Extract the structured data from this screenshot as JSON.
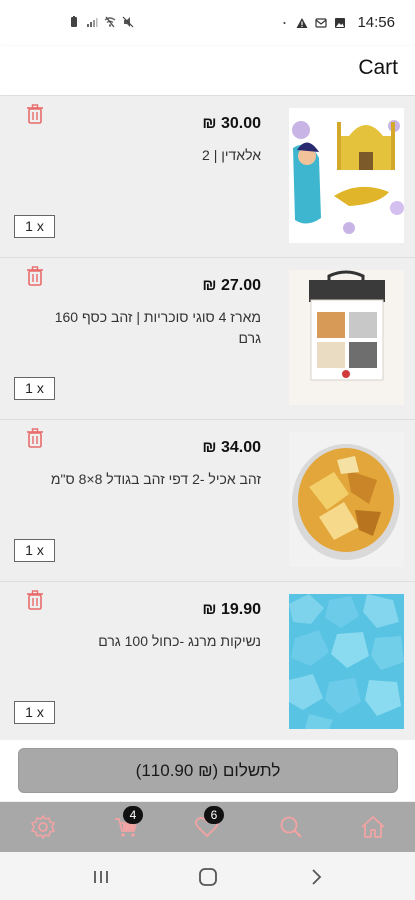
{
  "status_bar": {
    "time": "14:56"
  },
  "header": {
    "title": "Cart"
  },
  "cart": {
    "items": [
      {
        "price": "₪ 30.00",
        "name": "אלאדין | 2",
        "qty": "1 x"
      },
      {
        "price": "₪ 27.00",
        "name": "מארז 4 סוגי סוכריות | זהב כסף 160 גרם",
        "qty": "1 x"
      },
      {
        "price": "₪ 34.00",
        "name": "זהב אכיל -2 דפי זהב בגודל 8×8 ס\"מ",
        "qty": "1 x"
      },
      {
        "price": "₪ 19.90",
        "name": "נשיקות מרנג -כחול 100 גרם",
        "qty": "1 x"
      }
    ]
  },
  "checkout": {
    "label": "לתשלום (₪ 110.90)"
  },
  "bottom_nav": {
    "cart_badge": "4",
    "wishlist_badge": "6",
    "icon_color": "#f2a3a3"
  },
  "colors": {
    "trash": "#e96b6b",
    "nav_bg": "#a8a8a8",
    "checkout_bg": "#a8a8a8"
  }
}
